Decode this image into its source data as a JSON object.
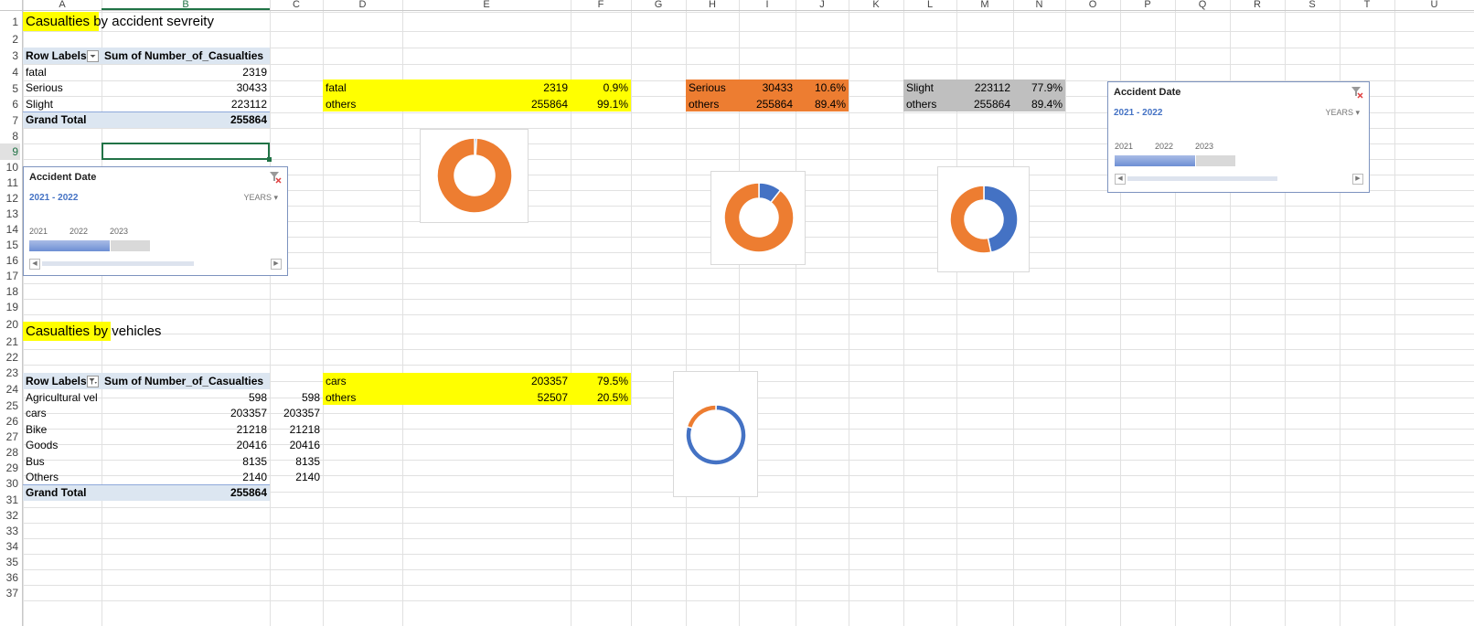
{
  "columns": [
    "A",
    "B",
    "C",
    "D",
    "E",
    "F",
    "G",
    "H",
    "I",
    "J",
    "K",
    "L",
    "M",
    "N",
    "O",
    "P",
    "Q",
    "R",
    "S",
    "T",
    "U"
  ],
  "rows": [
    "1",
    "2",
    "3",
    "4",
    "5",
    "6",
    "7",
    "8",
    "9",
    "10",
    "11",
    "12",
    "13",
    "14",
    "15",
    "16",
    "17",
    "18",
    "19",
    "20",
    "21",
    "22",
    "23",
    "24",
    "25",
    "26",
    "27",
    "28",
    "29",
    "30",
    "31",
    "32",
    "33",
    "34",
    "35",
    "36",
    "37"
  ],
  "colors": {
    "yellow": "#ffff00",
    "orange": "#ed7d31",
    "gray": "#bfbfbf",
    "blue": "#4472c4",
    "pivot_header": "#dce6f1"
  },
  "section1": {
    "title_highlight": "Casualties",
    "title_rest": " by accident sevreity",
    "pivot": {
      "header_row_labels": "Row Labels",
      "header_sum": "Sum of Number_of_Casualties",
      "rows": [
        {
          "label": "fatal",
          "value": "2319"
        },
        {
          "label": "Serious",
          "value": "30433"
        },
        {
          "label": "Slight",
          "value": "223112"
        }
      ],
      "grand_total_label": "Grand Total",
      "grand_total_value": "255864"
    },
    "fatal_table": [
      {
        "label": "fatal",
        "value": "2319",
        "pct": "0.9%"
      },
      {
        "label": "others",
        "value": "255864",
        "pct": "99.1%"
      }
    ],
    "serious_table": [
      {
        "label": "Serious",
        "value": "30433",
        "pct": "10.6%"
      },
      {
        "label": "others",
        "value": "255864",
        "pct": "89.4%"
      }
    ],
    "slight_table": [
      {
        "label": "Slight",
        "value": "223112",
        "pct": "77.9%"
      },
      {
        "label": "others",
        "value": "255864",
        "pct": "89.4%"
      }
    ]
  },
  "section2": {
    "title_highlight": "Casualties b",
    "title_rest": "y vehicles",
    "pivot": {
      "header_row_labels": "Row Labels",
      "header_sum": "Sum of Number_of_Casualties",
      "rows": [
        {
          "label": "Agricultural vel",
          "value": "598",
          "copy": "598"
        },
        {
          "label": "cars",
          "value": "203357",
          "copy": "203357"
        },
        {
          "label": "Bike",
          "value": "21218",
          "copy": "21218"
        },
        {
          "label": "Goods",
          "value": "20416",
          "copy": "20416"
        },
        {
          "label": "Bus",
          "value": "8135",
          "copy": "8135"
        },
        {
          "label": "Others",
          "value": "2140",
          "copy": "2140"
        }
      ],
      "grand_total_label": "Grand Total",
      "grand_total_value": "255864"
    },
    "cars_table": [
      {
        "label": "cars",
        "value": "203357",
        "pct": "79.5%"
      },
      {
        "label": "others",
        "value": "52507",
        "pct": "20.5%"
      }
    ]
  },
  "slicers": [
    {
      "title": "Accident Date",
      "range": "2021 - 2022",
      "level": "YEARS",
      "years": [
        "2021",
        "2022",
        "2023"
      ],
      "icon": "clear-filter-icon"
    },
    {
      "title": "Accident Date",
      "range": "2021 - 2022",
      "level": "YEARS",
      "years": [
        "2021",
        "2022",
        "2023"
      ],
      "icon": "clear-filter-icon"
    }
  ],
  "chart_data": [
    {
      "type": "pie",
      "donut": true,
      "categories": [
        "fatal",
        "others"
      ],
      "values": [
        0.9,
        99.1
      ],
      "colors": [
        "#4472c4",
        "#ed7d31"
      ],
      "title": ""
    },
    {
      "type": "pie",
      "donut": true,
      "categories": [
        "Serious",
        "others"
      ],
      "values": [
        10.6,
        89.4
      ],
      "colors": [
        "#4472c4",
        "#ed7d31"
      ],
      "title": ""
    },
    {
      "type": "pie",
      "donut": true,
      "categories": [
        "Slight",
        "others"
      ],
      "values": [
        46.6,
        53.4
      ],
      "colors": [
        "#4472c4",
        "#ed7d31"
      ],
      "title": ""
    },
    {
      "type": "pie",
      "donut": true,
      "categories": [
        "cars",
        "others"
      ],
      "values": [
        79.5,
        20.5
      ],
      "colors": [
        "#4472c4",
        "#ed7d31"
      ],
      "title": ""
    }
  ]
}
